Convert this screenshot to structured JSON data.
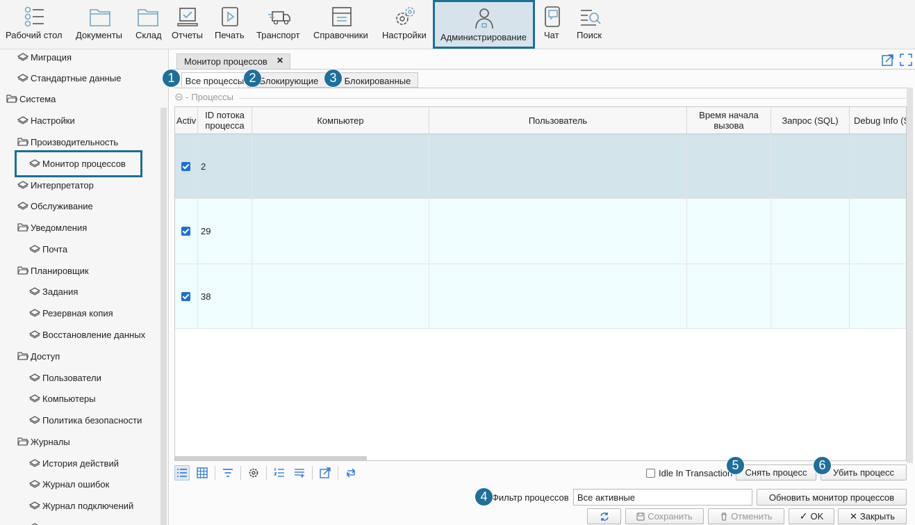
{
  "toolbar": {
    "items": [
      {
        "label": "Рабочий стол",
        "icon": "dashboard-icon"
      },
      {
        "label": "Документы",
        "icon": "folder-icon"
      },
      {
        "label": "Склад",
        "icon": "folder-icon"
      },
      {
        "label": "Отчеты",
        "icon": "reports-icon"
      },
      {
        "label": "Печать",
        "icon": "print-icon"
      },
      {
        "label": "Транспорт",
        "icon": "truck-icon"
      },
      {
        "label": "Справочники",
        "icon": "catalog-icon"
      },
      {
        "label": "Настройки",
        "icon": "gear-icon"
      },
      {
        "label": "Администрирование",
        "icon": "admin-user-icon"
      },
      {
        "label": "Чат",
        "icon": "chat-icon"
      },
      {
        "label": "Поиск",
        "icon": "search-icon"
      }
    ],
    "active": "Администрирование"
  },
  "sidebar": {
    "items": [
      {
        "label": "Миграция",
        "type": "item"
      },
      {
        "label": "Стандартные данные",
        "type": "item"
      },
      {
        "label": "Система",
        "type": "folder"
      },
      {
        "label": "Настройки",
        "type": "item"
      },
      {
        "label": "Производительность",
        "type": "folder"
      },
      {
        "label": "Монитор процессов",
        "type": "item"
      },
      {
        "label": "Интерпретатор",
        "type": "item"
      },
      {
        "label": "Обслуживание",
        "type": "item"
      },
      {
        "label": "Уведомления",
        "type": "folder"
      },
      {
        "label": "Почта",
        "type": "item"
      },
      {
        "label": "Планировщик",
        "type": "folder"
      },
      {
        "label": "Задания",
        "type": "item"
      },
      {
        "label": "Резервная копия",
        "type": "item"
      },
      {
        "label": "Восстановление данных",
        "type": "item"
      },
      {
        "label": "Доступ",
        "type": "folder"
      },
      {
        "label": "Пользователи",
        "type": "item"
      },
      {
        "label": "Компьютеры",
        "type": "item"
      },
      {
        "label": "Политика безопасности",
        "type": "item"
      },
      {
        "label": "Журналы",
        "type": "folder"
      },
      {
        "label": "История действий",
        "type": "item"
      },
      {
        "label": "Журнал ошибок",
        "type": "item"
      },
      {
        "label": "Журнал подключений",
        "type": "item"
      }
    ],
    "selected": "Монитор процессов"
  },
  "document_tab": {
    "label": "Монитор процессов",
    "close": "✕"
  },
  "sub_tabs": [
    "Все процессы",
    "Блокирующие",
    "Блокированные"
  ],
  "group_title": "Процессы",
  "grid": {
    "columns": [
      "Activ",
      "ID потока процесса",
      "Компьютер",
      "Пользователь",
      "Время начала вызова",
      "Запрос (SQL)",
      "Debug Info (S"
    ],
    "rows": [
      {
        "active": true,
        "id": "2"
      },
      {
        "active": true,
        "id": "29"
      },
      {
        "active": true,
        "id": "38"
      }
    ]
  },
  "idle_label": "Idle In Transaction",
  "buttons": {
    "cancel_process": "Снять процесс",
    "kill_process": "Убить процесс",
    "refresh_monitor": "Обновить монитор процессов",
    "save": "Сохранить",
    "undo": "Отменить",
    "ok": "OK",
    "close": "Закрыть"
  },
  "filter": {
    "label": "Фильтр процессов",
    "value": "Все активные"
  },
  "badges": [
    "1",
    "2",
    "3",
    "4",
    "5",
    "6"
  ],
  "colors": {
    "accent": "#1a6f99",
    "badge": "#1e6f9c",
    "row_selected": "#d3e4ea",
    "row_alt": "#effdfd",
    "checkbox": "#1e6fd9"
  }
}
